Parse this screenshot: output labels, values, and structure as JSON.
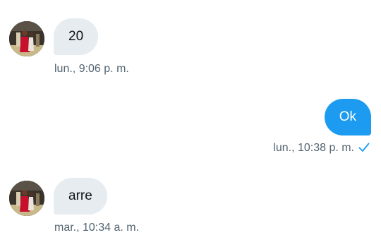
{
  "messages": [
    {
      "direction": "incoming",
      "text": "20",
      "timestamp": "lun., 9:06 p. m.",
      "avatar_icon": "user-avatar-icon"
    },
    {
      "direction": "outgoing",
      "text": "Ok",
      "timestamp": "lun., 10:38 p. m.",
      "status_icon": "checkmark-icon"
    },
    {
      "direction": "incoming",
      "text": "arre",
      "timestamp": "mar., 10:34 a. m.",
      "avatar_icon": "user-avatar-icon"
    }
  ],
  "colors": {
    "incoming_bubble": "#e6ecf0",
    "outgoing_bubble": "#1d9bf0",
    "timestamp_text": "#536471",
    "check": "#1d9bf0"
  }
}
